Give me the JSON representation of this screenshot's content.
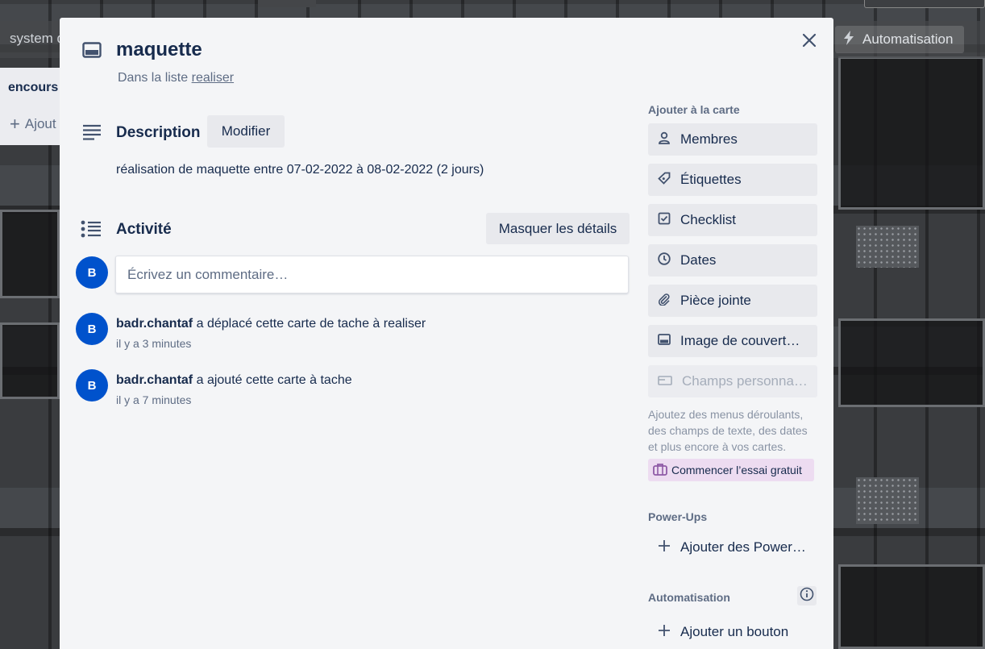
{
  "background": {
    "board_name": "system d",
    "automation_button": "Automatisation",
    "list_title": "encours",
    "add_card": "Ajout"
  },
  "card": {
    "title": "maquette",
    "in_list_prefix": "Dans la liste",
    "list_name": "realiser"
  },
  "description": {
    "heading": "Description",
    "edit_button": "Modifier",
    "text": "réalisation de maquette entre 07-02-2022 à 08-02-2022 (2 jours)"
  },
  "activity": {
    "heading": "Activité",
    "toggle_details": "Masquer les détails",
    "comment_placeholder": "Écrivez un commentaire…",
    "current_user_initial": "B",
    "entries": [
      {
        "initial": "B",
        "user": "badr.chantaf",
        "action": "a déplacé cette carte de tache à realiser",
        "time": "il y a 3 minutes"
      },
      {
        "initial": "B",
        "user": "badr.chantaf",
        "action": "a ajouté cette carte à tache",
        "time": "il y a 7 minutes"
      }
    ]
  },
  "sidebar": {
    "add_to_card_heading": "Ajouter à la carte",
    "items": [
      {
        "label": "Membres",
        "icon": "person-icon"
      },
      {
        "label": "Étiquettes",
        "icon": "tag-icon"
      },
      {
        "label": "Checklist",
        "icon": "checkbox-icon"
      },
      {
        "label": "Dates",
        "icon": "clock-icon"
      },
      {
        "label": "Pièce jointe",
        "icon": "paperclip-icon"
      },
      {
        "label": "Image de couvert…",
        "icon": "card-cover-icon"
      },
      {
        "label": "Champs personna…",
        "icon": "custom-fields-icon",
        "disabled": true
      }
    ],
    "custom_fields_note": "Ajoutez des menus déroulants, des champs de texte, des dates et plus encore à vos cartes.",
    "trial_button": "Commencer l’essai gratuit",
    "powerups_heading": "Power-Ups",
    "add_powerups": "Ajouter des Power…",
    "automation_heading": "Automatisation",
    "add_button": "Ajouter un bouton"
  },
  "colors": {
    "accent": "#0052cc",
    "modal_bg": "#f4f5f7",
    "button_bg": "#e8e9ed",
    "trial_bg": "#eddcf1",
    "text": "#172b4d",
    "muted": "#5e6c84"
  }
}
